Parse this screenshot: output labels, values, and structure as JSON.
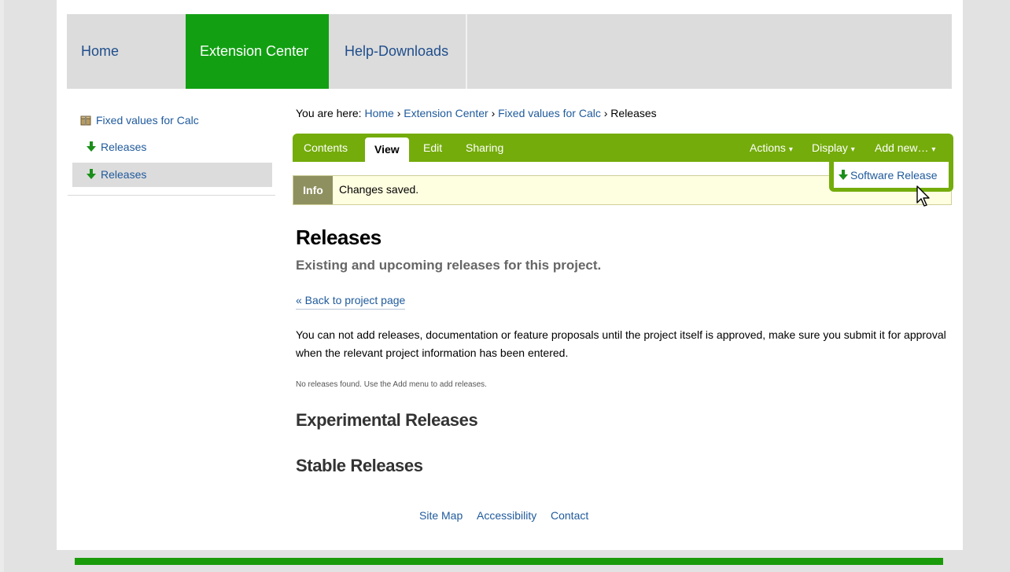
{
  "topnav": {
    "items": [
      {
        "label": "Home"
      },
      {
        "label": "Extension Center"
      },
      {
        "label": "Help-Downloads"
      }
    ]
  },
  "portlet": {
    "project_label": "Fixed values for Calc",
    "project_icon": "package-icon",
    "items": [
      {
        "label": "Releases",
        "icon": "green-down-arrow-icon"
      },
      {
        "label": "Releases",
        "icon": "green-down-arrow-icon",
        "selected": true
      }
    ]
  },
  "breadcrumb": {
    "prefix": "You are here:",
    "items": [
      "Home",
      "Extension Center",
      "Fixed values for Calc",
      "Releases"
    ],
    "separator": "›"
  },
  "editbar": {
    "tabs": [
      {
        "label": "Contents"
      },
      {
        "label": "View",
        "active": true
      },
      {
        "label": "Edit"
      },
      {
        "label": "Sharing"
      }
    ],
    "menus": [
      {
        "label": "Actions"
      },
      {
        "label": "Display"
      },
      {
        "label": "Add new…"
      }
    ],
    "dropdown_marker": "▾",
    "color": "#74ac0b"
  },
  "add_menu": {
    "items": [
      {
        "label": "Software Release",
        "icon": "green-down-arrow-icon"
      }
    ]
  },
  "status_message": {
    "label": "Info",
    "text": "Changes saved."
  },
  "content": {
    "title": "Releases",
    "description": "Existing and upcoming releases for this project.",
    "back_link": "« Back to project page",
    "notice": "You can not add releases, documentation or feature proposals until the project itself is approved, make sure you submit it for approval when the relevant project information has been entered.",
    "empty_text": "No releases found. Use the Add menu to add releases.",
    "sections": [
      "Experimental Releases",
      "Stable Releases"
    ]
  },
  "footer": {
    "links": [
      "Site Map",
      "Accessibility",
      "Contact"
    ]
  },
  "colors": {
    "nav_active": "#12a012",
    "link": "#1f5a9c",
    "bottom_bar": "#1a9c0a"
  }
}
